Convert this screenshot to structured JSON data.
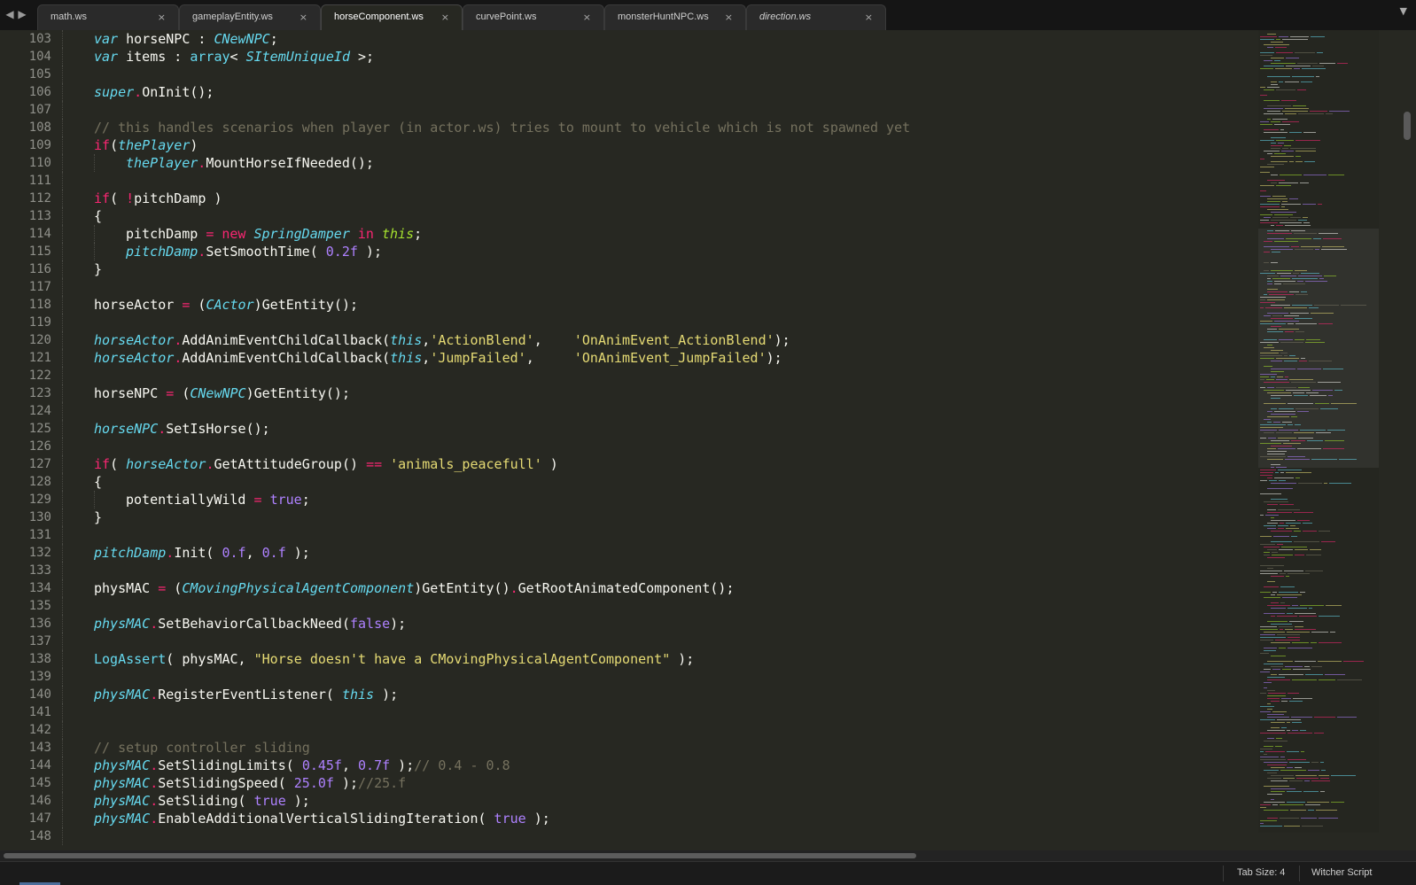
{
  "tabbar": {
    "nav_back_icon": "◀",
    "nav_forward_icon": "▶",
    "close_glyph": "×",
    "menu_glyph": "▼",
    "tabs": [
      {
        "label": "math.ws",
        "active": false,
        "italic": false
      },
      {
        "label": "gameplayEntity.ws",
        "active": false,
        "italic": false
      },
      {
        "label": "horseComponent.ws",
        "active": true,
        "italic": false
      },
      {
        "label": "curvePoint.ws",
        "active": false,
        "italic": false
      },
      {
        "label": "monsterHuntNPC.ws",
        "active": false,
        "italic": false
      },
      {
        "label": "direction.ws",
        "active": false,
        "italic": true
      }
    ]
  },
  "editor": {
    "theme_colors": {
      "background": "#272822",
      "keyword": "#f92672",
      "type": "#66d9ef",
      "constant": "#ae81ff",
      "string": "#e6db74",
      "comment": "#75715e",
      "plain": "#f8f8f2",
      "line_number": "#8f908a"
    },
    "lines": [
      {
        "n": "103",
        "indent": 1,
        "tokens": [
          [
            "var",
            "i"
          ],
          [
            " horseNPC : ",
            "d"
          ],
          [
            "CNewNPC",
            "i"
          ],
          [
            ";",
            "d"
          ]
        ]
      },
      {
        "n": "104",
        "indent": 1,
        "tokens": [
          [
            "var",
            "i"
          ],
          [
            " items : ",
            "d"
          ],
          [
            "array",
            "b"
          ],
          [
            "< ",
            "d"
          ],
          [
            "SItemUniqueId",
            "i"
          ],
          [
            " >;",
            "d"
          ]
        ]
      },
      {
        "n": "105",
        "indent": 0,
        "tokens": []
      },
      {
        "n": "106",
        "indent": 1,
        "tokens": [
          [
            "super",
            "i"
          ],
          [
            ".",
            "k"
          ],
          [
            "OnInit();",
            "d"
          ]
        ]
      },
      {
        "n": "107",
        "indent": 0,
        "tokens": []
      },
      {
        "n": "108",
        "indent": 1,
        "tokens": [
          [
            "// this handles scenarios when player (in actor.ws) tries to mount to vehicle which is not spawned yet",
            "c"
          ]
        ]
      },
      {
        "n": "109",
        "indent": 1,
        "tokens": [
          [
            "if",
            "k"
          ],
          [
            "(",
            "d"
          ],
          [
            "thePlayer",
            "i"
          ],
          [
            ")",
            "d"
          ]
        ]
      },
      {
        "n": "110",
        "indent": 2,
        "tokens": [
          [
            "thePlayer",
            "i"
          ],
          [
            ".",
            "k"
          ],
          [
            "MountHorseIfNeeded();",
            "d"
          ]
        ]
      },
      {
        "n": "111",
        "indent": 0,
        "tokens": []
      },
      {
        "n": "112",
        "indent": 1,
        "tokens": [
          [
            "if",
            "k"
          ],
          [
            "( ",
            "d"
          ],
          [
            "!",
            "k"
          ],
          [
            "pitchDamp )",
            "d"
          ]
        ]
      },
      {
        "n": "113",
        "indent": 1,
        "tokens": [
          [
            "{",
            "d"
          ]
        ]
      },
      {
        "n": "114",
        "indent": 2,
        "tokens": [
          [
            "pitchDamp ",
            "d"
          ],
          [
            "=",
            "k"
          ],
          [
            " ",
            "d"
          ],
          [
            "new",
            "k"
          ],
          [
            " ",
            "d"
          ],
          [
            "SpringDamper",
            "i"
          ],
          [
            " ",
            "d"
          ],
          [
            "in",
            "k"
          ],
          [
            " ",
            "d"
          ],
          [
            "this",
            "w"
          ],
          [
            ";",
            "d"
          ]
        ]
      },
      {
        "n": "115",
        "indent": 2,
        "tokens": [
          [
            "pitchDamp",
            "i"
          ],
          [
            ".",
            "k"
          ],
          [
            "SetSmoothTime( ",
            "d"
          ],
          [
            "0.2f",
            "n"
          ],
          [
            " );",
            "d"
          ]
        ]
      },
      {
        "n": "116",
        "indent": 1,
        "tokens": [
          [
            "}",
            "d"
          ]
        ]
      },
      {
        "n": "117",
        "indent": 0,
        "tokens": []
      },
      {
        "n": "118",
        "indent": 1,
        "tokens": [
          [
            "horseActor ",
            "d"
          ],
          [
            "=",
            "k"
          ],
          [
            " (",
            "d"
          ],
          [
            "CActor",
            "i"
          ],
          [
            ")GetEntity();",
            "d"
          ]
        ]
      },
      {
        "n": "119",
        "indent": 0,
        "tokens": []
      },
      {
        "n": "120",
        "indent": 1,
        "tokens": [
          [
            "horseActor",
            "i"
          ],
          [
            ".",
            "k"
          ],
          [
            "AddAnimEventChildCallback(",
            "d"
          ],
          [
            "this",
            "i"
          ],
          [
            ",",
            "d"
          ],
          [
            "'ActionBlend'",
            "s"
          ],
          [
            ",    ",
            "d"
          ],
          [
            "'OnAnimEvent_ActionBlend'",
            "s"
          ],
          [
            ");",
            "d"
          ]
        ]
      },
      {
        "n": "121",
        "indent": 1,
        "tokens": [
          [
            "horseActor",
            "i"
          ],
          [
            ".",
            "k"
          ],
          [
            "AddAnimEventChildCallback(",
            "d"
          ],
          [
            "this",
            "i"
          ],
          [
            ",",
            "d"
          ],
          [
            "'JumpFailed'",
            "s"
          ],
          [
            ",     ",
            "d"
          ],
          [
            "'OnAnimEvent_JumpFailed'",
            "s"
          ],
          [
            ");",
            "d"
          ]
        ]
      },
      {
        "n": "122",
        "indent": 0,
        "tokens": []
      },
      {
        "n": "123",
        "indent": 1,
        "tokens": [
          [
            "horseNPC ",
            "d"
          ],
          [
            "=",
            "k"
          ],
          [
            " (",
            "d"
          ],
          [
            "CNewNPC",
            "i"
          ],
          [
            ")GetEntity();",
            "d"
          ]
        ]
      },
      {
        "n": "124",
        "indent": 0,
        "tokens": []
      },
      {
        "n": "125",
        "indent": 1,
        "tokens": [
          [
            "horseNPC",
            "i"
          ],
          [
            ".",
            "k"
          ],
          [
            "SetIsHorse();",
            "d"
          ]
        ]
      },
      {
        "n": "126",
        "indent": 0,
        "tokens": []
      },
      {
        "n": "127",
        "indent": 1,
        "tokens": [
          [
            "if",
            "k"
          ],
          [
            "( ",
            "d"
          ],
          [
            "horseActor",
            "i"
          ],
          [
            ".",
            "k"
          ],
          [
            "GetAttitudeGroup() ",
            "d"
          ],
          [
            "==",
            "k"
          ],
          [
            " ",
            "d"
          ],
          [
            "'animals_peacefull'",
            "s"
          ],
          [
            " )",
            "d"
          ]
        ]
      },
      {
        "n": "128",
        "indent": 1,
        "tokens": [
          [
            "{",
            "d"
          ]
        ]
      },
      {
        "n": "129",
        "indent": 2,
        "tokens": [
          [
            "potentiallyWild ",
            "d"
          ],
          [
            "=",
            "k"
          ],
          [
            " ",
            "d"
          ],
          [
            "true",
            "u"
          ],
          [
            ";",
            "d"
          ]
        ]
      },
      {
        "n": "130",
        "indent": 1,
        "tokens": [
          [
            "}",
            "d"
          ]
        ]
      },
      {
        "n": "131",
        "indent": 0,
        "tokens": []
      },
      {
        "n": "132",
        "indent": 1,
        "tokens": [
          [
            "pitchDamp",
            "i"
          ],
          [
            ".",
            "k"
          ],
          [
            "Init( ",
            "d"
          ],
          [
            "0.f",
            "n"
          ],
          [
            ", ",
            "d"
          ],
          [
            "0.f",
            "n"
          ],
          [
            " );",
            "d"
          ]
        ]
      },
      {
        "n": "133",
        "indent": 0,
        "tokens": []
      },
      {
        "n": "134",
        "indent": 1,
        "tokens": [
          [
            "physMAC ",
            "d"
          ],
          [
            "=",
            "k"
          ],
          [
            " (",
            "d"
          ],
          [
            "CMovingPhysicalAgentComponent",
            "i"
          ],
          [
            ")GetEntity()",
            "d"
          ],
          [
            ".",
            "k"
          ],
          [
            "GetRootAnimatedComponent();",
            "d"
          ]
        ]
      },
      {
        "n": "135",
        "indent": 0,
        "tokens": []
      },
      {
        "n": "136",
        "indent": 1,
        "tokens": [
          [
            "physMAC",
            "i"
          ],
          [
            ".",
            "k"
          ],
          [
            "SetBehaviorCallbackNeed(",
            "d"
          ],
          [
            "false",
            "u"
          ],
          [
            ");",
            "d"
          ]
        ]
      },
      {
        "n": "137",
        "indent": 0,
        "tokens": []
      },
      {
        "n": "138",
        "indent": 1,
        "tokens": [
          [
            "LogAssert",
            "b"
          ],
          [
            "( physMAC, ",
            "d"
          ],
          [
            "\"Horse doesn't have a CMovingPhysicalAgentComponent\"",
            "s"
          ],
          [
            " );",
            "d"
          ]
        ]
      },
      {
        "n": "139",
        "indent": 0,
        "tokens": []
      },
      {
        "n": "140",
        "indent": 1,
        "tokens": [
          [
            "physMAC",
            "i"
          ],
          [
            ".",
            "k"
          ],
          [
            "RegisterEventListener( ",
            "d"
          ],
          [
            "this",
            "i"
          ],
          [
            " );",
            "d"
          ]
        ]
      },
      {
        "n": "141",
        "indent": 0,
        "tokens": []
      },
      {
        "n": "142",
        "indent": 0,
        "tokens": []
      },
      {
        "n": "143",
        "indent": 1,
        "tokens": [
          [
            "// setup controller sliding",
            "c"
          ]
        ]
      },
      {
        "n": "144",
        "indent": 1,
        "tokens": [
          [
            "physMAC",
            "i"
          ],
          [
            ".",
            "k"
          ],
          [
            "SetSlidingLimits( ",
            "d"
          ],
          [
            "0.45f",
            "n"
          ],
          [
            ", ",
            "d"
          ],
          [
            "0.7f",
            "n"
          ],
          [
            " );",
            "d"
          ],
          [
            "// 0.4 - 0.8",
            "c"
          ]
        ]
      },
      {
        "n": "145",
        "indent": 1,
        "tokens": [
          [
            "physMAC",
            "i"
          ],
          [
            ".",
            "k"
          ],
          [
            "SetSlidingSpeed( ",
            "d"
          ],
          [
            "25.0f",
            "n"
          ],
          [
            " );",
            "d"
          ],
          [
            "//25.f",
            "c"
          ]
        ]
      },
      {
        "n": "146",
        "indent": 1,
        "tokens": [
          [
            "physMAC",
            "i"
          ],
          [
            ".",
            "k"
          ],
          [
            "SetSliding( ",
            "d"
          ],
          [
            "true",
            "u"
          ],
          [
            " );",
            "d"
          ]
        ]
      },
      {
        "n": "147",
        "indent": 1,
        "tokens": [
          [
            "physMAC",
            "i"
          ],
          [
            ".",
            "k"
          ],
          [
            "EnableAdditionalVerticalSlidingIteration( ",
            "d"
          ],
          [
            "true",
            "u"
          ],
          [
            " );",
            "d"
          ]
        ]
      },
      {
        "n": "148",
        "indent": 0,
        "tokens": []
      }
    ]
  },
  "statusbar": {
    "tab_size": "Tab Size: 4",
    "syntax": "Witcher Script"
  }
}
